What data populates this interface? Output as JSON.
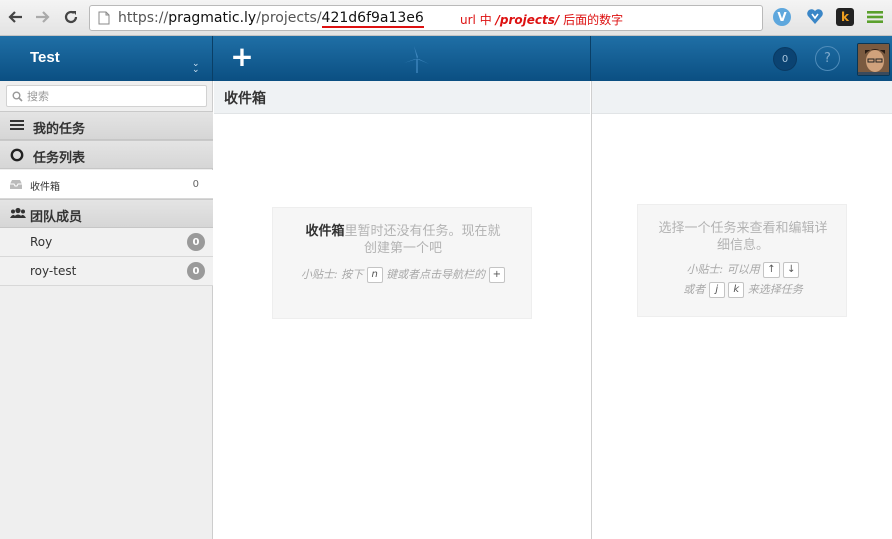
{
  "browser": {
    "url_prefix": "https://",
    "url_host": "pragmatic.ly",
    "url_path": "/projects/",
    "url_hash": "421d6f9a13e6",
    "annotation_prefix": "url 中 ",
    "annotation_path": "/projects/",
    "annotation_suffix": " 后面的数字",
    "annotation_color": "#dd1111"
  },
  "header": {
    "project_name": "Test",
    "add_label": "+",
    "notifications_count": "0",
    "help_label": "?",
    "brand_color": "#0b4f82"
  },
  "sidebar": {
    "search_placeholder": "搜索",
    "my_tasks": "我的任务",
    "task_lists": "任务列表",
    "inbox_label": "收件箱",
    "inbox_count": "0",
    "team_members": "团队成员",
    "members": [
      {
        "name": "Roy",
        "count": "0"
      },
      {
        "name": "roy-test",
        "count": "0"
      }
    ]
  },
  "center": {
    "title": "收件箱",
    "empty_strong": "收件箱",
    "empty_rest": "里暂时还没有任务。现在就创建第一个吧",
    "tip_prefix": "小贴士: 按下",
    "tip_key": "n",
    "tip_middle": "键或者点击导航栏的",
    "tip_key2": "+"
  },
  "detail": {
    "message": "选择一个任务来查看和编辑详细信息。",
    "tip_prefix": "小贴士: 可以用",
    "key_up": "↑",
    "key_down": "↓",
    "tip_or": "或者",
    "key_j": "j",
    "key_k": "k",
    "tip_suffix": "来选择任务"
  }
}
